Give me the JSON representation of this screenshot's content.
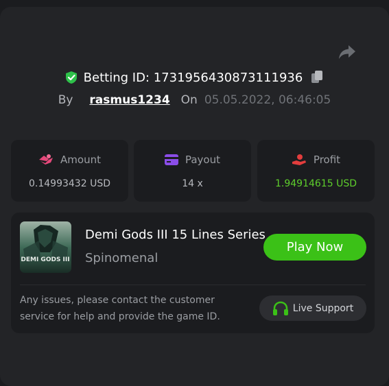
{
  "bet": {
    "label": "Betting ID: 1731956430873111936",
    "by_label": "By",
    "username": "rasmus1234",
    "on_label": "On",
    "date": "05.05.2022, 06:46:05"
  },
  "stats": [
    {
      "label": "Amount",
      "value": "0.14993432 USD",
      "icon": "coins-icon"
    },
    {
      "label": "Payout",
      "value": "14 x",
      "icon": "card-icon"
    },
    {
      "label": "Profit",
      "value": "1.94914615 USD",
      "icon": "hand-coin-icon"
    }
  ],
  "game": {
    "title": "Demi Gods III 15 Lines Series",
    "provider": "Spinomenal",
    "thumb_text": "DEMI GODS III",
    "play_label": "Play Now"
  },
  "support": {
    "text": "Any issues, please contact the customer service for help and provide the game ID.",
    "button_label": "Live Support"
  },
  "colors": {
    "background": "#1b1c1f",
    "panel": "#232427",
    "accent_green": "#3bc117",
    "profit_green": "#5ece2c",
    "verified_green": "#2ec14a",
    "amount_pink": "#e5487a",
    "payout_purple": "#8b4de8",
    "profit_red": "#e23d3d"
  }
}
